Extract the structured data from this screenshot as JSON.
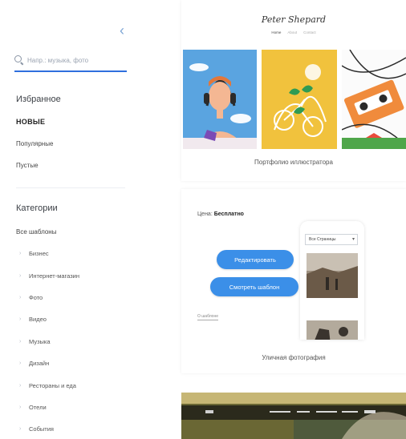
{
  "sidebar": {
    "collapse_icon": "chevron-left-icon",
    "search_placeholder": "Напр.: музыка, фото",
    "featured_heading": "Избранное",
    "featured_items": [
      "НОВЫЕ",
      "Популярные",
      "Пустые"
    ],
    "categories_heading": "Категории",
    "all_templates": "Все шаблоны",
    "categories": [
      "Бизнес",
      "Интернет-магазин",
      "Фото",
      "Видео",
      "Музыка",
      "Дизайн",
      "Рестораны и еда",
      "Отели",
      "События"
    ]
  },
  "main": {
    "card1": {
      "brand": "Peter Shepard",
      "nav": [
        "Home",
        "About",
        "Contact"
      ],
      "caption": "Портфолио иллюстратора"
    },
    "card2": {
      "price_label": "Цена:",
      "price_value": "Бесплатно",
      "edit_button": "Редактировать",
      "view_button": "Смотреть шаблон",
      "small_link": "О шаблоне",
      "phone_select": "Все Страницы",
      "caption": "Уличная фотография"
    }
  },
  "colors": {
    "accent": "#3b8fe8",
    "search_underline": "#2f6fdd"
  }
}
